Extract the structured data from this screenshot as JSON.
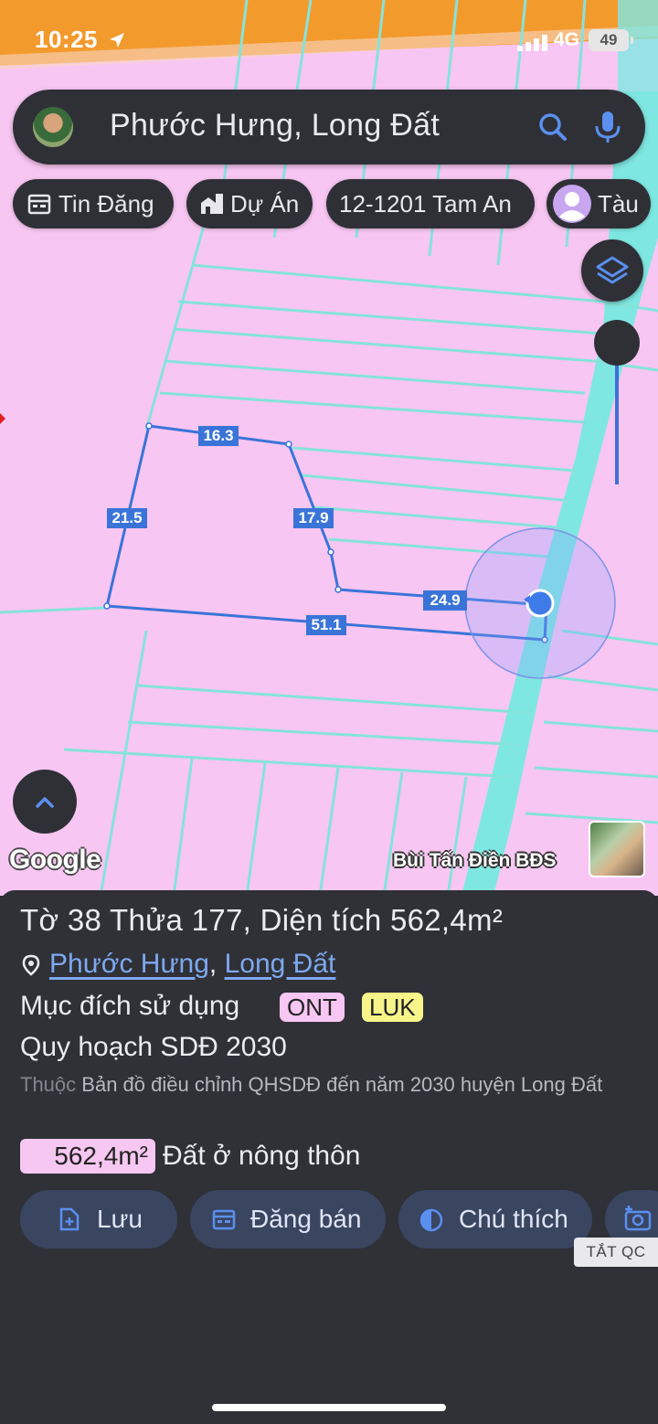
{
  "status_bar": {
    "time": "10:25",
    "network": "4G",
    "battery": "49"
  },
  "search": {
    "query": "Phước Hưng, Long Đất"
  },
  "chips": [
    {
      "label": "Tin Đăng",
      "icon": "calendar-icon"
    },
    {
      "label": "Dự Án",
      "icon": "building-icon"
    },
    {
      "label": "12-1201 Tam An",
      "icon": ""
    },
    {
      "label": "Tàu",
      "icon": "profile-icon"
    }
  ],
  "map": {
    "segment_labels": [
      "16.3",
      "21.5",
      "17.9",
      "24.9",
      "51.1"
    ],
    "google_logo": "Google",
    "watermark": "Bùi Tấn Điền BĐS",
    "colors": {
      "land": "#f8c6f2",
      "road": "#7fe7e2",
      "parcel_line": "#3a74d8",
      "top_zone": "#f39a2d"
    }
  },
  "parcel": {
    "title": "Tờ 38 Thửa 177, Diện tích 562,4m²",
    "location": [
      "Phước Hưng",
      "Long Đất"
    ],
    "location_sep": ",",
    "purpose_label": "Mục đích sử dụng",
    "purpose_tags": [
      {
        "code": "ONT",
        "color": "#f8c6f2"
      },
      {
        "code": "LUK",
        "color": "#f7f48a"
      }
    ],
    "plan_title": "Quy hoạch SDĐ 2030",
    "note_prefix": "Thuộc",
    "note_text": "Bản đồ điều chỉnh QHSDĐ đến năm 2030 huyện Long Đất",
    "area_value": "562,4m²",
    "area_type": "Đất ở nông thôn"
  },
  "actions": [
    {
      "label": "Lưu",
      "icon": "add-file-icon"
    },
    {
      "label": "Đăng bán",
      "icon": "calendar-icon"
    },
    {
      "label": "Chú thích",
      "icon": "contrast-icon"
    },
    {
      "label": "",
      "icon": "add-photo-icon"
    }
  ],
  "ad_toggle": "TẮT QC"
}
